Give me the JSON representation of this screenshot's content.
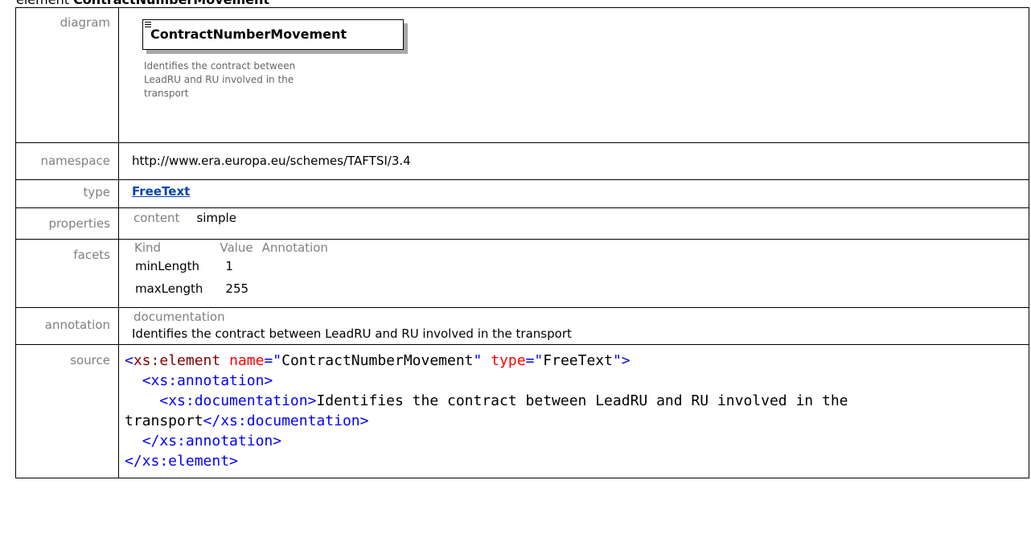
{
  "heading": {
    "prefix": "element ",
    "name": "ContractNumberMovement"
  },
  "rows": {
    "diagram": {
      "label": "diagram",
      "element_name": "ContractNumberMovement",
      "note": "Identifies the contract between LeadRU and RU involved in the transport"
    },
    "namespace": {
      "label": "namespace",
      "value": "http://www.era.europa.eu/schemes/TAFTSI/3.4"
    },
    "type": {
      "label": "type",
      "value": "FreeText"
    },
    "properties": {
      "label": "properties",
      "key": "content",
      "value": "simple"
    },
    "facets": {
      "label": "facets",
      "headers": [
        "Kind",
        "Value",
        "Annotation"
      ],
      "items": [
        {
          "kind": "minLength",
          "value": "1"
        },
        {
          "kind": "maxLength",
          "value": "255"
        }
      ]
    },
    "annotation": {
      "label": "annotation",
      "head": "documentation",
      "text": "Identifies the contract between LeadRU and RU involved in the transport"
    },
    "source": {
      "label": "source",
      "lines": {
        "l1_open": "<",
        "l1_tag": "xs:element",
        "l1_attr1": "name",
        "l1_eq1": "=\"",
        "l1_val1": "ContractNumberMovement",
        "l1_q1": "\"",
        "l1_attr2": "type",
        "l1_eq2": "=\"",
        "l1_val2": "FreeText",
        "l1_close": "\">",
        "l2": "<xs:annotation>",
        "l3_open": "<xs:documentation>",
        "l3_text": "Identifies the contract between LeadRU and RU involved in the transport",
        "l3_close": "</xs:documentation>",
        "l4": "</xs:annotation>",
        "l5": "</xs:element>"
      }
    }
  }
}
